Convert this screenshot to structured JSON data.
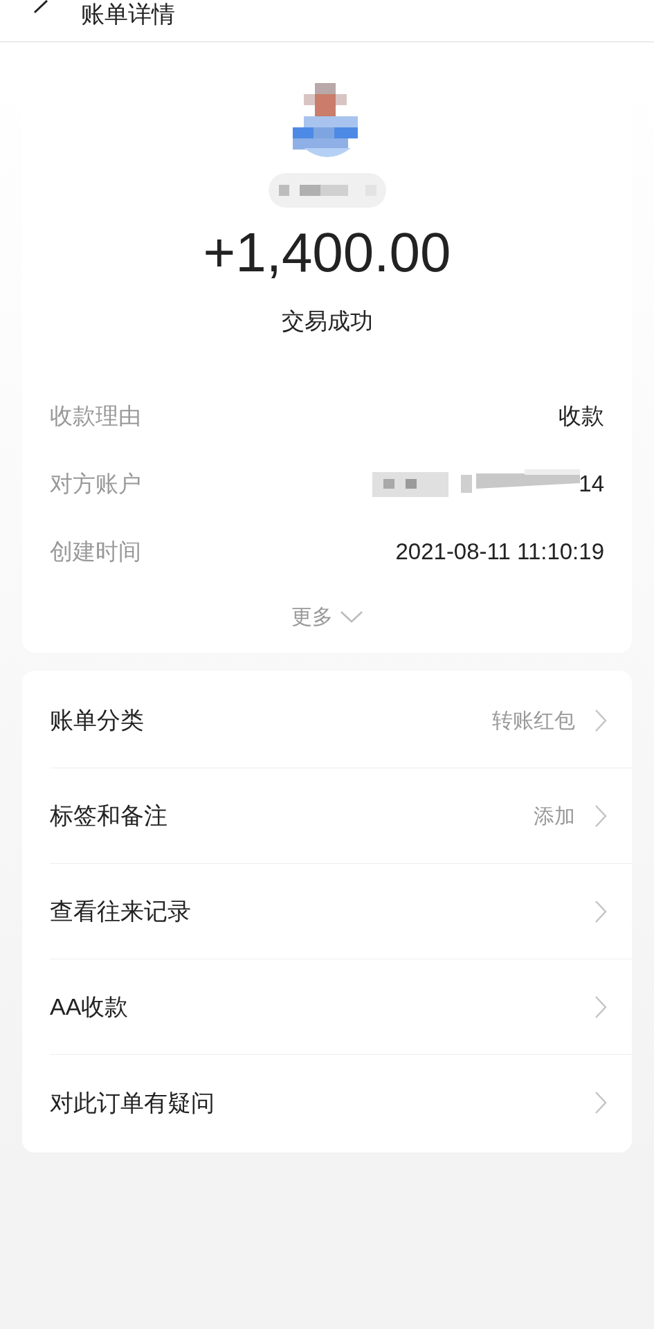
{
  "header": {
    "title": "账单详情"
  },
  "summary": {
    "amount": "+1,400.00",
    "status": "交易成功"
  },
  "details": [
    {
      "label": "收款理由",
      "value": "收款"
    },
    {
      "label": "对方账户",
      "value": "14",
      "masked": true
    },
    {
      "label": "创建时间",
      "value": "2021-08-11 11:10:19"
    }
  ],
  "more": "更多",
  "actions": [
    {
      "label": "账单分类",
      "value": "转账红包"
    },
    {
      "label": "标签和备注",
      "value": "添加"
    },
    {
      "label": "查看往来记录"
    },
    {
      "label": "AA收款"
    },
    {
      "label": "对此订单有疑问"
    }
  ]
}
